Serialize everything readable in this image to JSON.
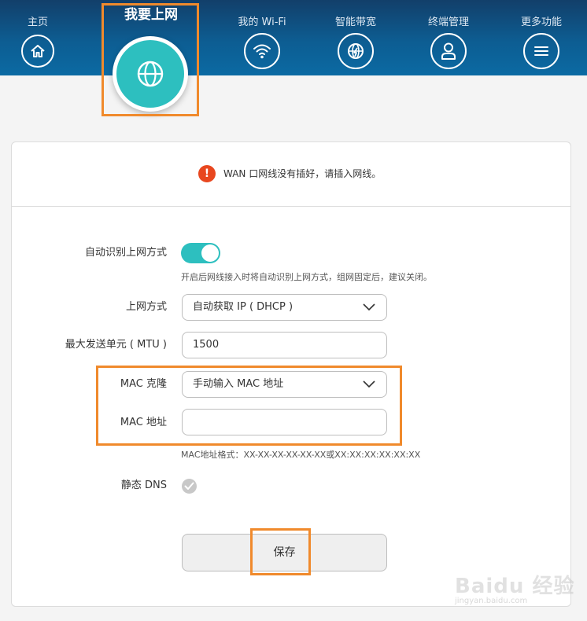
{
  "nav": {
    "items": [
      {
        "label": "主页",
        "icon": "home-icon"
      },
      {
        "label": "我要上网",
        "icon": "globe-icon",
        "active": true
      },
      {
        "label": "我的 Wi-Fi",
        "icon": "wifi-icon"
      },
      {
        "label": "智能带宽",
        "icon": "bandwidth-icon"
      },
      {
        "label": "终端管理",
        "icon": "user-icon"
      },
      {
        "label": "更多功能",
        "icon": "menu-icon"
      }
    ]
  },
  "warning": {
    "icon": "exclamation-icon",
    "mark": "!",
    "text": "WAN 口网线没有插好，请插入网线。"
  },
  "form": {
    "auto_detect": {
      "label": "自动识别上网方式",
      "enabled": true,
      "hint": "开启后网线接入时将自动识别上网方式，组网固定后，建议关闭。"
    },
    "connection_type": {
      "label": "上网方式",
      "value": "自动获取 IP ( DHCP )"
    },
    "mtu": {
      "label": "最大发送单元 ( MTU )",
      "value": "1500"
    },
    "mac_clone": {
      "label": "MAC 克隆",
      "value": "手动输入 MAC 地址"
    },
    "mac_address": {
      "label": "MAC 地址",
      "value": "",
      "hint": "MAC地址格式：XX-XX-XX-XX-XX-XX或XX:XX:XX:XX:XX:XX"
    },
    "static_dns": {
      "label": "静态 DNS",
      "checked": false
    }
  },
  "save_label": "保存",
  "watermark": {
    "text": "Baidu 经验",
    "sub": "jingyan.baidu.com"
  },
  "colors": {
    "header": "#0d5d92",
    "accent": "#2dbfbf",
    "warning": "#e8471f",
    "highlight": "#f08a2c"
  }
}
